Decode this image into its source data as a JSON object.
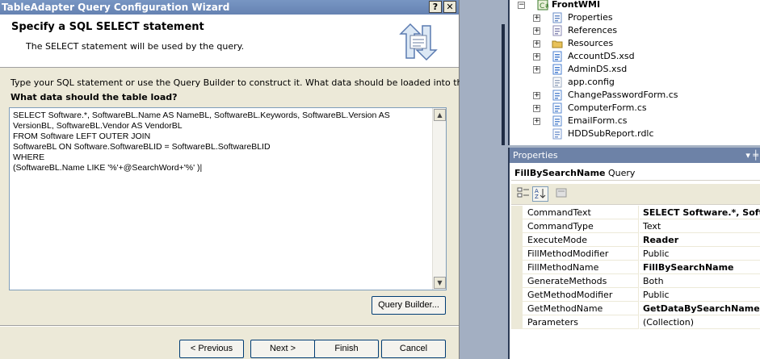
{
  "wizard": {
    "title": "TableAdapter Query Configuration Wizard",
    "help_glyph": "?",
    "close_glyph": "✕",
    "heading": "Specify a SQL SELECT statement",
    "subheading": "The SELECT statement will be used by the query.",
    "instruction": "Type your SQL statement or use the Query Builder to construct it. What data should be loaded into the table?",
    "question": "What data should the table load?",
    "sql": "SELECT Software.*, SoftwareBL.Name AS NameBL, SoftwareBL.Keywords, SoftwareBL.Version AS\nVersionBL, SoftwareBL.Vendor AS VendorBL\nFROM Software LEFT OUTER JOIN\nSoftwareBL ON Software.SoftwareBLID = SoftwareBL.SoftwareBLID\nWHERE\n(SoftwareBL.Name LIKE '%'+@SearchWord+'%' )|",
    "scroll_up": "▲",
    "scroll_down": "▼",
    "buttons": {
      "query_builder": "Query Builder...",
      "previous": "< Previous",
      "next": "Next >",
      "finish": "Finish",
      "cancel": "Cancel"
    }
  },
  "solution_explorer": {
    "project": "FrontWMI",
    "items": [
      {
        "label": "Properties",
        "icon": "properties-icon",
        "expandable": true
      },
      {
        "label": "References",
        "icon": "references-icon",
        "expandable": true
      },
      {
        "label": "Resources",
        "icon": "folder-icon",
        "expandable": true
      },
      {
        "label": "AccountDS.xsd",
        "icon": "dataset-icon",
        "expandable": true
      },
      {
        "label": "AdminDS.xsd",
        "icon": "dataset-icon",
        "expandable": true
      },
      {
        "label": "app.config",
        "icon": "config-icon",
        "expandable": false
      },
      {
        "label": "ChangePasswordForm.cs",
        "icon": "form-icon",
        "expandable": true
      },
      {
        "label": "ComputerForm.cs",
        "icon": "form-icon",
        "expandable": true
      },
      {
        "label": "EmailForm.cs",
        "icon": "form-icon",
        "expandable": true
      },
      {
        "label": "HDDSubReport.rdlc",
        "icon": "report-icon",
        "expandable": false
      }
    ]
  },
  "properties": {
    "title": "Properties",
    "pin_glyph": "▾ ╪",
    "object_name": "FillBySearchName",
    "object_type": "Query",
    "rows": [
      {
        "name": "CommandText",
        "value": "SELECT Software.*, SoftwareBL.Name AS NameBL",
        "bold": true
      },
      {
        "name": "CommandType",
        "value": "Text",
        "bold": false
      },
      {
        "name": "ExecuteMode",
        "value": "Reader",
        "bold": true
      },
      {
        "name": "FillMethodModifier",
        "value": "Public",
        "bold": false
      },
      {
        "name": "FillMethodName",
        "value": "FillBySearchName",
        "bold": true
      },
      {
        "name": "GenerateMethods",
        "value": "Both",
        "bold": false
      },
      {
        "name": "GetMethodModifier",
        "value": "Public",
        "bold": false
      },
      {
        "name": "GetMethodName",
        "value": "GetDataBySearchName",
        "bold": true
      },
      {
        "name": "Parameters",
        "value": "(Collection)",
        "bold": false
      }
    ]
  },
  "colors": {
    "titlebar": "#6f8dbf",
    "dialog_bg": "#ece9d8",
    "accent": "#1f2c44"
  }
}
